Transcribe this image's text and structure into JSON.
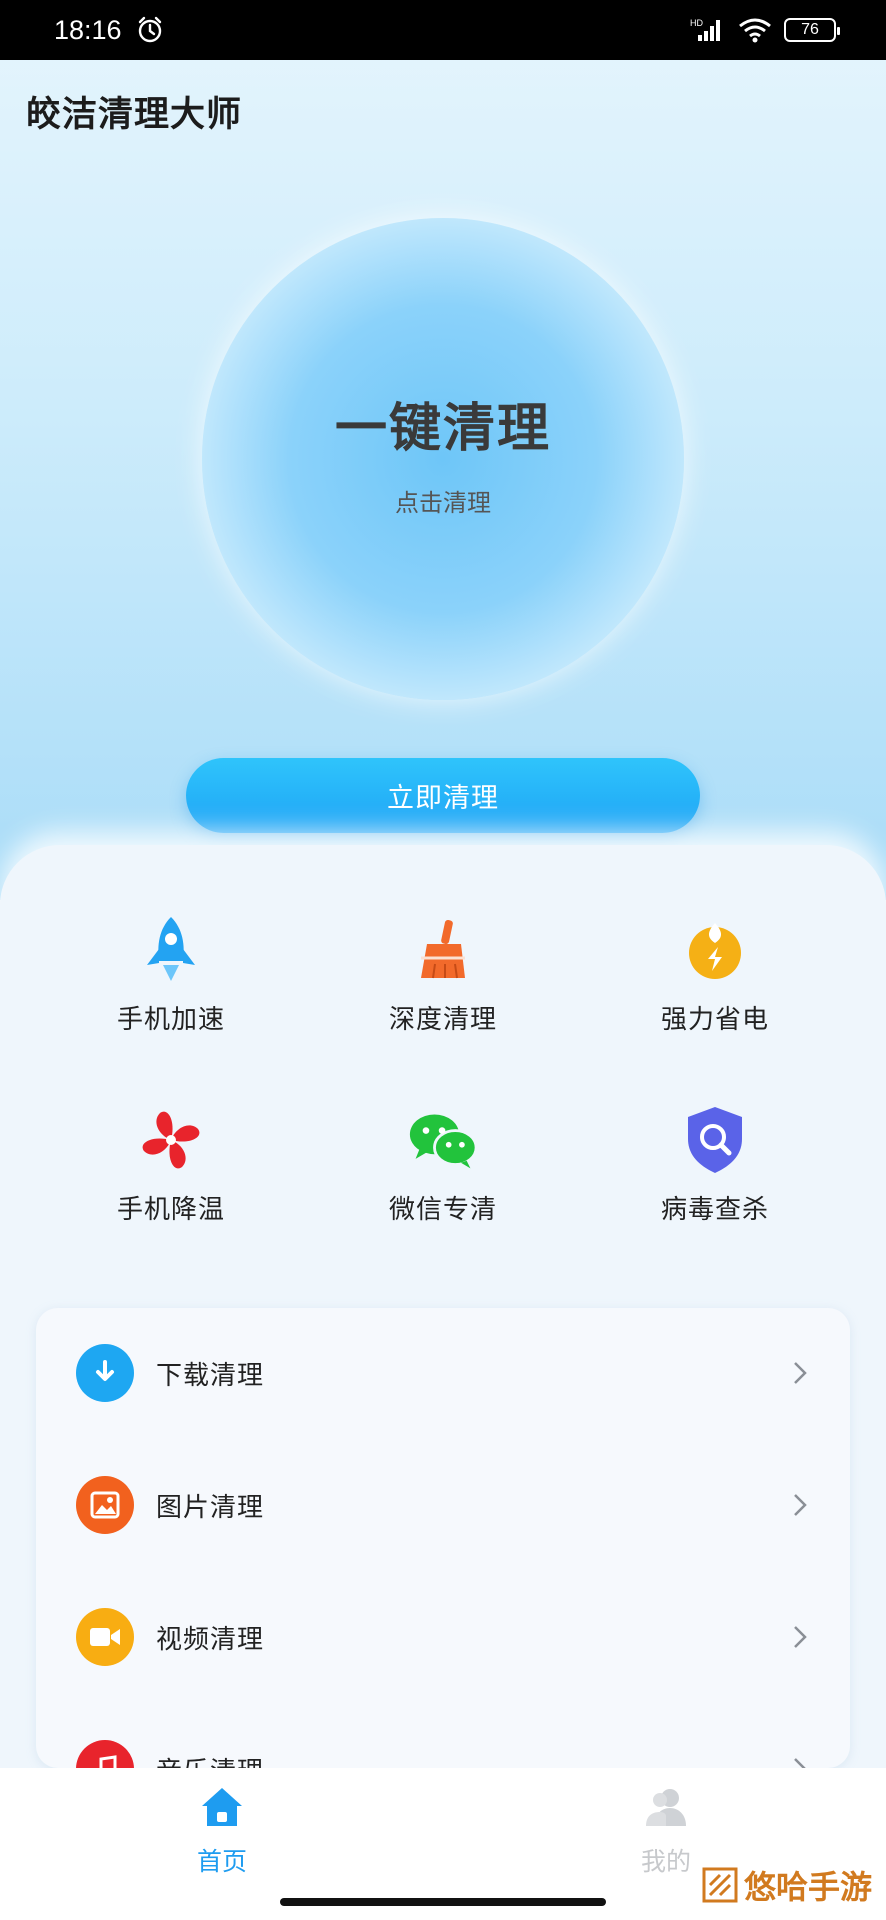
{
  "status_bar": {
    "time": "18:16",
    "network": "HD",
    "battery": "76"
  },
  "app": {
    "title": "皎洁清理大师"
  },
  "hero": {
    "title": "一键清理",
    "subtitle": "点击清理",
    "button_label": "立即清理"
  },
  "features": [
    {
      "label": "手机加速",
      "icon": "rocket-icon",
      "color": "#23a3f2"
    },
    {
      "label": "深度清理",
      "icon": "broom-icon",
      "color": "#f26a2b"
    },
    {
      "label": "强力省电",
      "icon": "battery-saver-icon",
      "color": "#f5b015"
    },
    {
      "label": "手机降温",
      "icon": "fan-icon",
      "color": "#e8242c"
    },
    {
      "label": "微信专清",
      "icon": "wechat-icon",
      "color": "#22c33c"
    },
    {
      "label": "病毒查杀",
      "icon": "shield-search-icon",
      "color": "#5a63e8"
    }
  ],
  "list": [
    {
      "label": "下载清理",
      "icon": "download-icon",
      "color": "#1ea7f2"
    },
    {
      "label": "图片清理",
      "icon": "image-icon",
      "color": "#f2611e"
    },
    {
      "label": "视频清理",
      "icon": "video-icon",
      "color": "#f8ad12"
    },
    {
      "label": "音乐清理",
      "icon": "music-icon",
      "color": "#e8242c"
    }
  ],
  "nav": [
    {
      "label": "首页",
      "icon": "home-icon",
      "active": true
    },
    {
      "label": "我的",
      "icon": "user-icon",
      "active": false
    }
  ],
  "colors": {
    "accent": "#1e9cf0",
    "inactive": "#c7c9cc"
  },
  "watermark": {
    "text": "悠哈手游"
  }
}
